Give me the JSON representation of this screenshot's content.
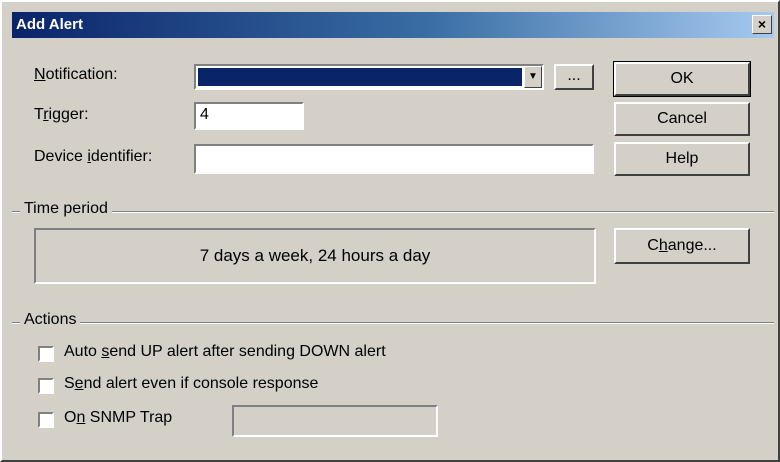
{
  "window": {
    "title": "Add Alert",
    "close_glyph": "×"
  },
  "form": {
    "notification_label": {
      "pre": "",
      "acc": "N",
      "post": "otification:"
    },
    "notification_value": "",
    "browse_label": "...",
    "trigger_label": {
      "pre": "T",
      "acc": "r",
      "post": "igger:"
    },
    "trigger_value": "4",
    "device_label": {
      "pre": "Device ",
      "acc": "i",
      "post": "dentifier:"
    },
    "device_value": ""
  },
  "buttons": {
    "ok": "OK",
    "cancel": "Cancel",
    "help": "Help",
    "change": {
      "pre": "C",
      "acc": "h",
      "post": "ange..."
    }
  },
  "time_period": {
    "group_label": "Time period",
    "summary": "7 days a week, 24 hours a day"
  },
  "actions": {
    "group_label": "Actions",
    "items": [
      {
        "pre": "Auto ",
        "acc": "s",
        "post": "end UP alert after sending DOWN alert",
        "checked": false
      },
      {
        "pre": "S",
        "acc": "e",
        "post": "nd alert even if console response",
        "checked": false
      },
      {
        "pre": "O",
        "acc": "n",
        "post": " SNMP Trap",
        "checked": false
      }
    ],
    "snmp_trap_value": ""
  }
}
